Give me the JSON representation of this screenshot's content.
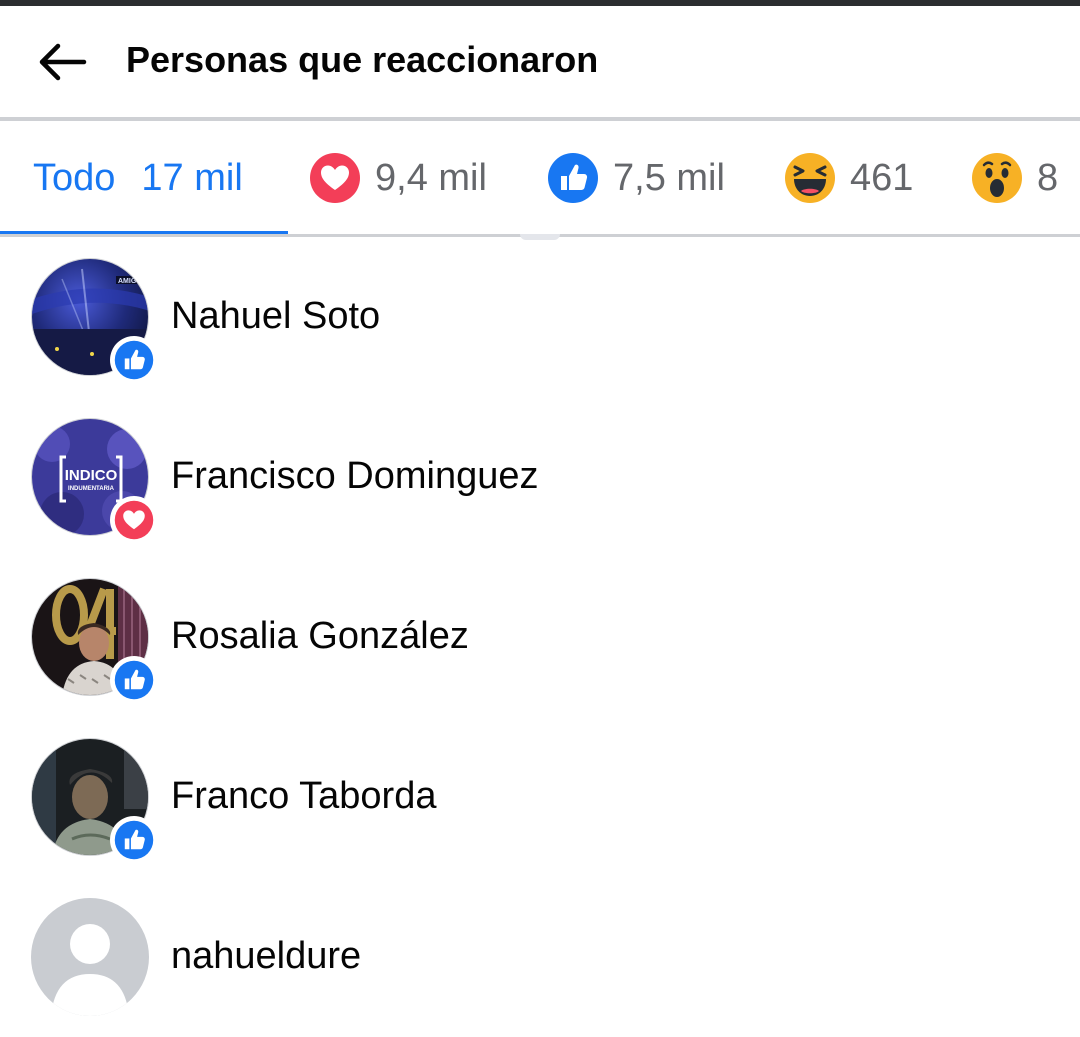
{
  "header": {
    "back_icon": "arrow-left-icon",
    "title": "Personas que reaccionaron"
  },
  "tabs": [
    {
      "id": "all",
      "label": "Todo",
      "count": "17 mil",
      "selected": true
    },
    {
      "id": "love",
      "icon": "love-reaction-icon",
      "count": "9,4 mil"
    },
    {
      "id": "like",
      "icon": "like-reaction-icon",
      "count": "7,5 mil"
    },
    {
      "id": "haha",
      "icon": "haha-reaction-icon",
      "count": "461"
    },
    {
      "id": "wow",
      "icon": "wow-reaction-icon",
      "count": "8"
    }
  ],
  "reactors": [
    {
      "name": "Nahuel Soto",
      "reaction": "like"
    },
    {
      "name": "Francisco Dominguez",
      "reaction": "love"
    },
    {
      "name": "Rosalia González",
      "reaction": "like"
    },
    {
      "name": "Franco Taborda",
      "reaction": "like"
    },
    {
      "name": "nahueldure",
      "reaction": "none"
    }
  ],
  "avatar_text": {
    "francisco_logo_line1": "INDICO",
    "francisco_logo_line2": "INDUMENTARIA",
    "nahuel_banner": "AMIGO"
  },
  "colors": {
    "accent": "#1877f2",
    "love": "#f33e58",
    "like": "#1877f2",
    "haha_wow": "#f7b125",
    "divider": "#ced0d4",
    "secondary_text": "#65676b"
  }
}
